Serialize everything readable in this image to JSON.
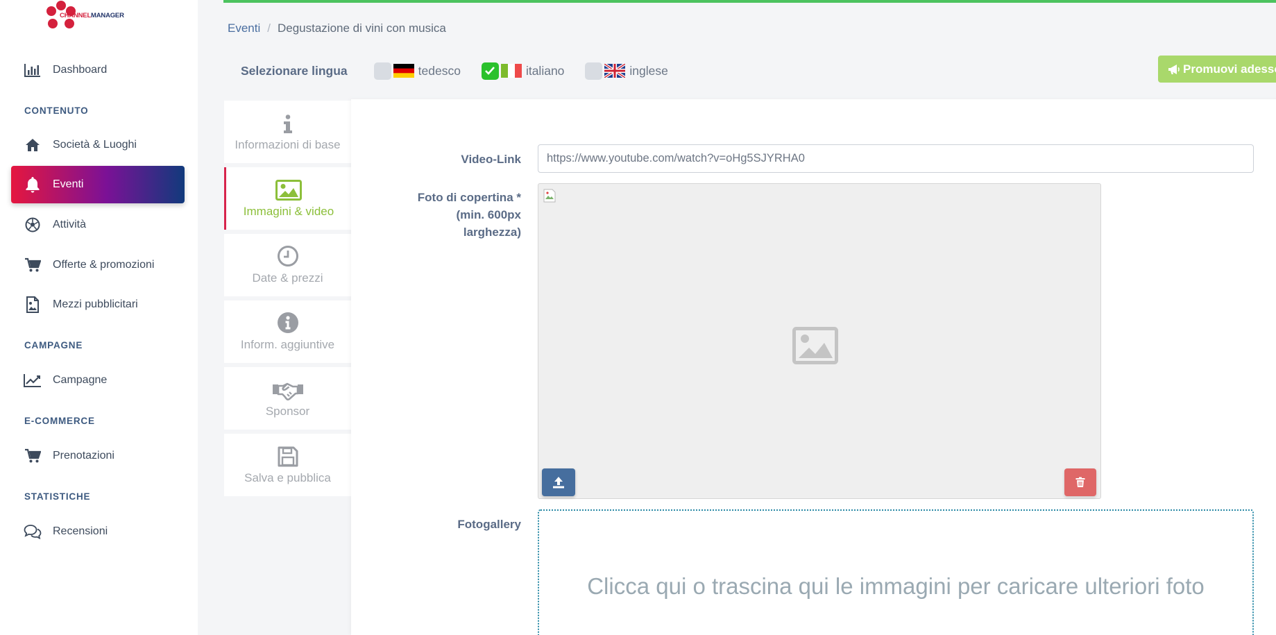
{
  "logo": {
    "part1": "CHANNEL",
    "part2": "MANAGER"
  },
  "sidebar": {
    "dashboard": "Dashboard",
    "sections": {
      "contenuto": "CONTENUTO",
      "campagne": "CAMPAGNE",
      "ecommerce": "E-COMMERCE",
      "statistiche": "STATISTICHE"
    },
    "items": {
      "societa": "Società & Luoghi",
      "eventi": "Eventi",
      "attivita": "Attività",
      "offerte": "Offerte & promozioni",
      "mezzi": "Mezzi pubblicitari",
      "campagne": "Campagne",
      "prenotazioni": "Prenotazioni",
      "recensioni": "Recensioni"
    },
    "active_item": "eventi"
  },
  "breadcrumb": {
    "parent": "Eventi",
    "separator": "/",
    "current": "Degustazione di vini con musica"
  },
  "language": {
    "label": "Selezionare lingua",
    "options": [
      {
        "name": "tedesco",
        "checked": false
      },
      {
        "name": "italiano",
        "checked": true
      },
      {
        "name": "inglese",
        "checked": false
      }
    ]
  },
  "promote_button": "Promuovi adesso",
  "tabs": [
    {
      "label": "Informazioni di base",
      "icon": "info-icon"
    },
    {
      "label": "Immagini & video",
      "icon": "image-icon",
      "active": true
    },
    {
      "label": "Date & prezzi",
      "icon": "clock-icon"
    },
    {
      "label": "Inform. aggiuntive",
      "icon": "info-circle-icon"
    },
    {
      "label": "Sponsor",
      "icon": "handshake-icon"
    },
    {
      "label": "Salva e pubblica",
      "icon": "save-icon"
    }
  ],
  "form": {
    "video_label": "Video-Link",
    "video_value": "https://www.youtube.com/watch?v=oHg5SJYRHA0",
    "cover_label_1": "Foto di copertina *",
    "cover_label_2": "(min. 600px",
    "cover_label_3": "larghezza)",
    "gallery_label": "Fotogallery",
    "dropzone_text": "Clicca qui o trascina qui le immagini per caricare ulteriori foto"
  },
  "colors": {
    "accent_green": "#4cc35f",
    "active_gradient_start": "#e5173f",
    "active_gradient_end": "#113a7c",
    "promote_button": "#a9d86b",
    "upload_button": "#466e9e",
    "delete_button": "#df6767"
  }
}
